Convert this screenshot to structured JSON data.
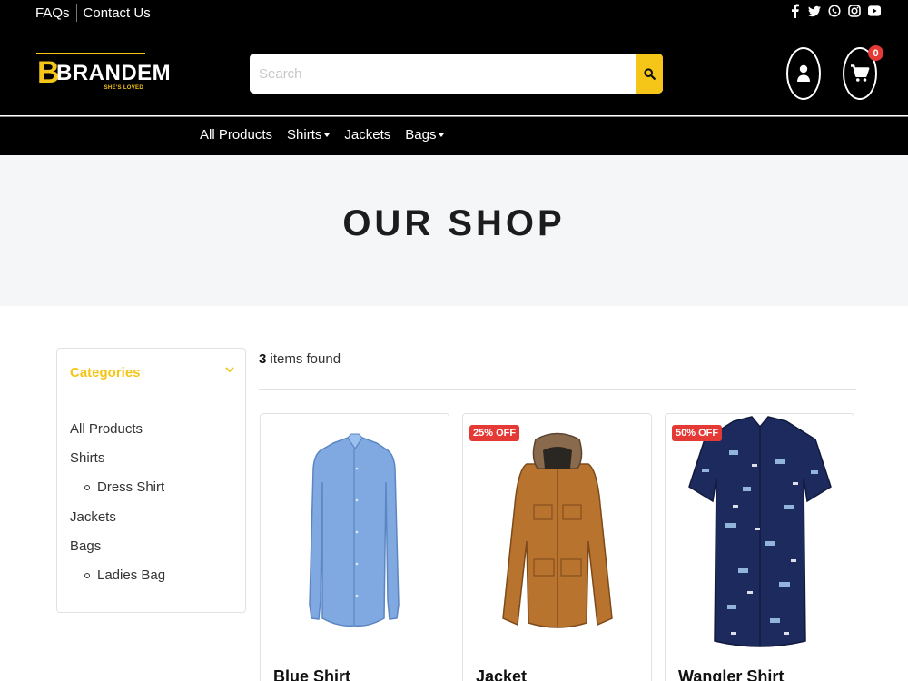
{
  "top_links": [
    "FAQs",
    "Contact Us"
  ],
  "social_icons": [
    "facebook-icon",
    "twitter-icon",
    "whatsapp-icon",
    "instagram-icon",
    "youtube-icon"
  ],
  "logo": {
    "letter": "B",
    "word": "BRANDEM",
    "tagline": "SHE'S LOVED"
  },
  "search": {
    "placeholder": "Search",
    "value": ""
  },
  "cart": {
    "count": "0"
  },
  "nav": [
    {
      "label": "All Products",
      "dropdown": false
    },
    {
      "label": "Shirts",
      "dropdown": true
    },
    {
      "label": "Jackets",
      "dropdown": false
    },
    {
      "label": "Bags",
      "dropdown": true
    }
  ],
  "hero": {
    "title": "OUR SHOP"
  },
  "sidebar": {
    "heading": "Categories",
    "items": [
      {
        "label": "All Products",
        "level": 0
      },
      {
        "label": "Shirts",
        "level": 0
      },
      {
        "label": "Dress Shirt",
        "level": 1
      },
      {
        "label": "Jackets",
        "level": 0
      },
      {
        "label": "Bags",
        "level": 0
      },
      {
        "label": "Ladies Bag",
        "level": 1
      }
    ]
  },
  "results": {
    "count": "3",
    "suffix": " items found"
  },
  "products": [
    {
      "name": "Blue Shirt",
      "discount": ""
    },
    {
      "name": "Jacket",
      "discount": "25% OFF"
    },
    {
      "name": "Wangler Shirt",
      "discount": "50% OFF"
    }
  ],
  "colors": {
    "accent": "#f5c518",
    "badge": "#e53935",
    "header": "#000000",
    "hero_bg": "#f5f6f8"
  }
}
